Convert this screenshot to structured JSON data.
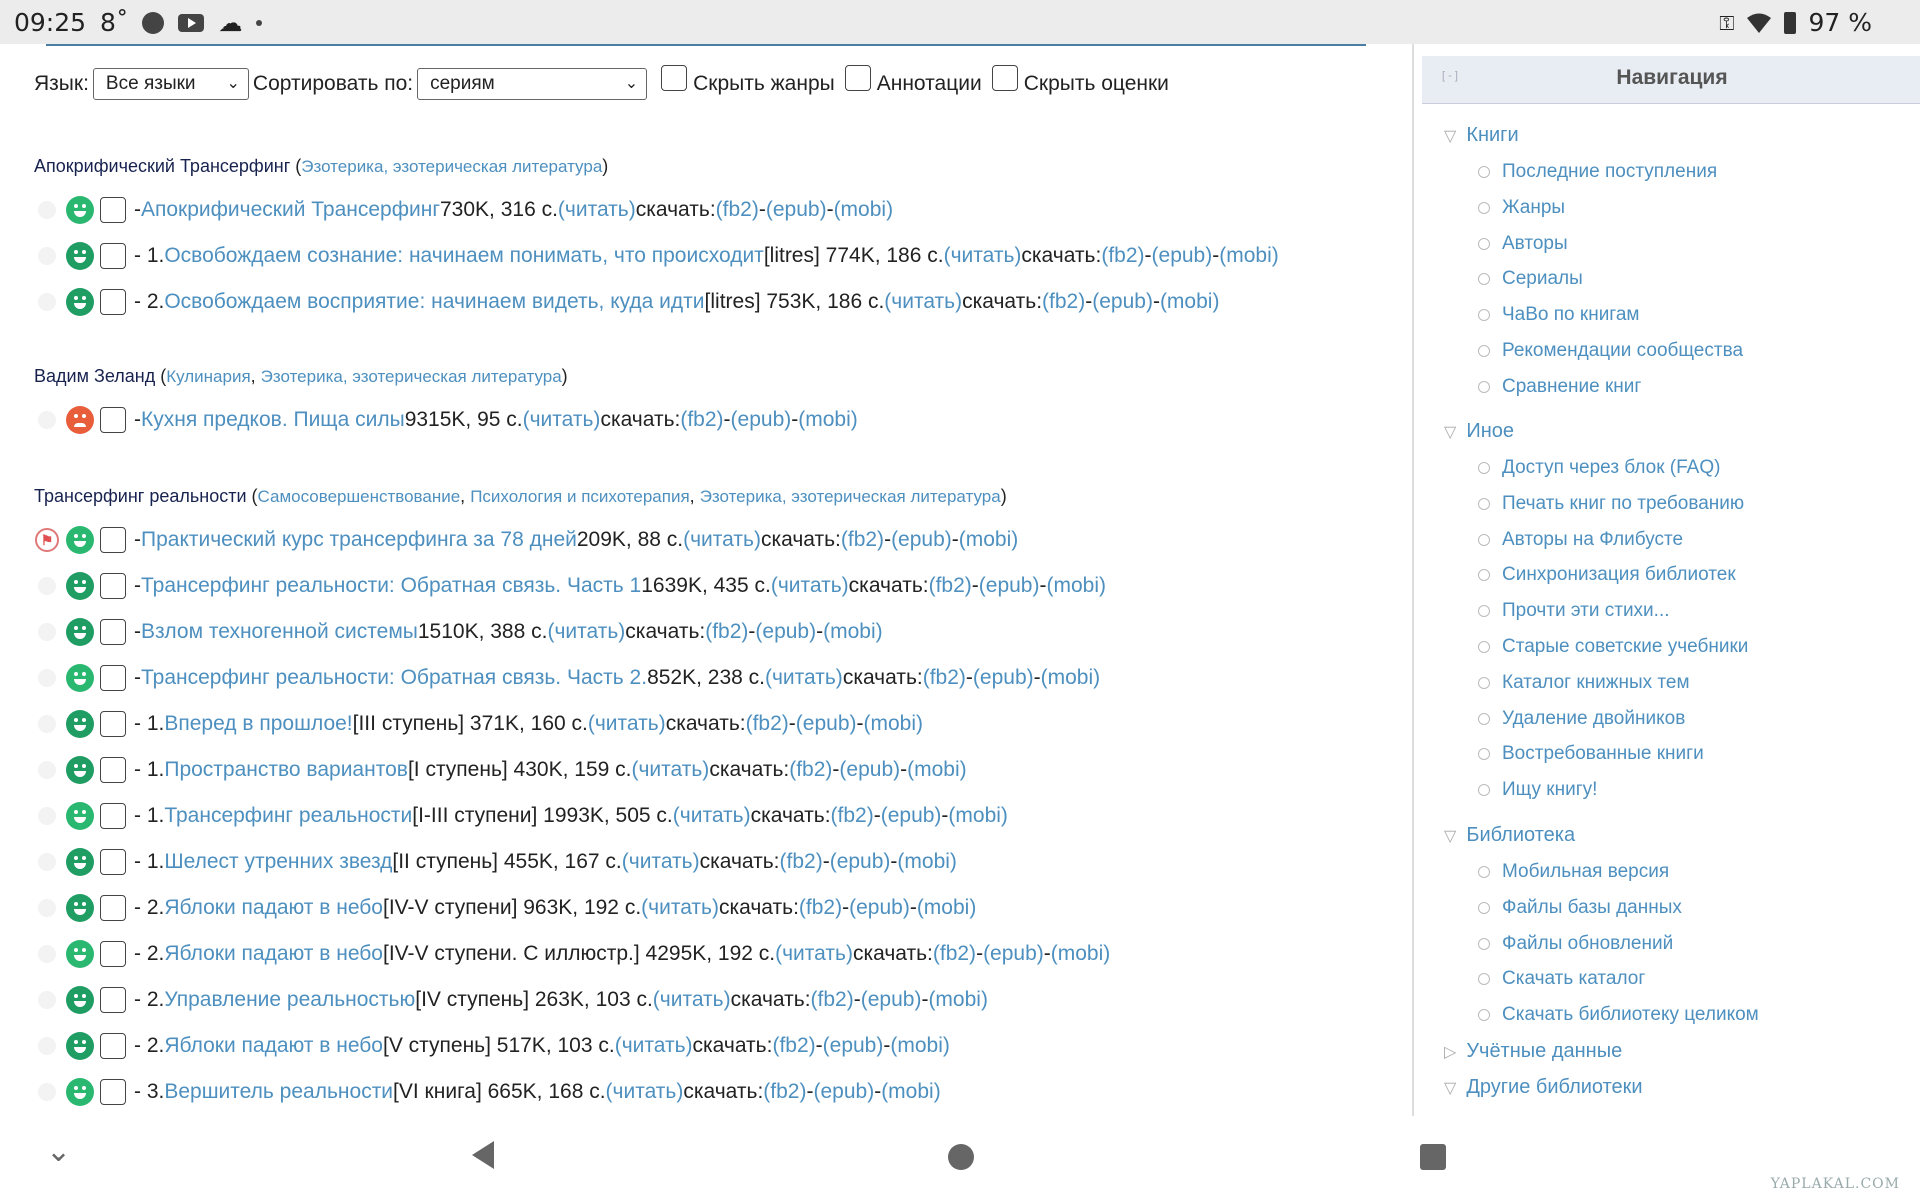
{
  "status_bar": {
    "time": "09:25",
    "temp": "8˚",
    "battery": "97 %"
  },
  "controls": {
    "lang_label": "Язык:",
    "lang_value": "Все языки",
    "sort_label": "Сортировать по:",
    "sort_value": "сериям",
    "hide_genres": "Скрыть жанры",
    "annotations": "Аннотации",
    "hide_ratings": "Скрыть оценки"
  },
  "groups": [
    {
      "title": "Апокрифический Трансерфинг",
      "genres": [
        "Эзотерика, эзотерическая литература"
      ],
      "books": [
        {
          "mark": "ghost",
          "face": "green",
          "prefix": "- ",
          "title": "Апокрифический Трансерфинг",
          "info": " 730K, 316 с. "
        },
        {
          "mark": "ghost",
          "face": "green",
          "prefix": "- 1. ",
          "title": "Освобождаем сознание: начинаем понимать, что происходит",
          "info": " [litres] 774K, 186 с. "
        },
        {
          "mark": "ghost",
          "face": "green",
          "prefix": "- 2. ",
          "title": "Освобождаем восприятие: начинаем видеть, куда идти",
          "info": " [litres] 753K, 186 с. "
        }
      ]
    },
    {
      "title": "Вадим Зеланд",
      "genres": [
        "Кулинария",
        "Эзотерика, эзотерическая литература"
      ],
      "books": [
        {
          "mark": "ghost",
          "face": "sad",
          "prefix": "- ",
          "title": "Кухня предков. Пища силы",
          "info": " 9315K, 95 с. "
        }
      ]
    },
    {
      "title": "Трансерфинг реальности",
      "genres": [
        "Самосовершенствование",
        "Психология и психотерапия",
        "Эзотерика, эзотерическая литература"
      ],
      "books": [
        {
          "mark": "flag",
          "face": "green",
          "prefix": "- ",
          "title": "Практический курс трансерфинга за 78 дней",
          "info": " 209K, 88 с. "
        },
        {
          "mark": "ghost",
          "face": "green",
          "prefix": "- ",
          "title": "Трансерфинг реальности: Обратная связь. Часть 1",
          "info": " 1639K, 435 с. "
        },
        {
          "mark": "ghost",
          "face": "green",
          "prefix": "- ",
          "title": "Взлом техногенной системы",
          "info": " 1510K, 388 с. "
        },
        {
          "mark": "ghost",
          "face": "green",
          "prefix": "- ",
          "title": "Трансерфинг реальности: Обратная связь. Часть 2.",
          "info": " 852K, 238 с. "
        },
        {
          "mark": "ghost",
          "face": "green",
          "prefix": "- 1. ",
          "title": "Вперед в прошлое!",
          "info": " [III ступень] 371K, 160 с. "
        },
        {
          "mark": "ghost",
          "face": "green",
          "prefix": "- 1. ",
          "title": "Пространство вариантов",
          "info": " [I ступень] 430K, 159 с. "
        },
        {
          "mark": "ghost",
          "face": "green",
          "prefix": "- 1. ",
          "title": "Трансерфинг реальности",
          "info": " [I-III ступени] 1993K, 505 с. "
        },
        {
          "mark": "ghost",
          "face": "green",
          "prefix": "- 1. ",
          "title": "Шелест утренних звезд",
          "info": " [II ступень] 455K, 167 с. "
        },
        {
          "mark": "ghost",
          "face": "green",
          "prefix": "- 2. ",
          "title": "Яблоки падают в небо",
          "info": " [IV-V ступени] 963K, 192 с. "
        },
        {
          "mark": "ghost",
          "face": "green",
          "prefix": "- 2. ",
          "title": "Яблоки падают в небо",
          "info": " [IV-V ступени. С иллюстр.] 4295K, 192 с. "
        },
        {
          "mark": "ghost",
          "face": "green",
          "prefix": "- 2. ",
          "title": "Управление реальностью",
          "info": " [IV ступень] 263K, 103 с. "
        },
        {
          "mark": "ghost",
          "face": "green",
          "prefix": "- 2. ",
          "title": "Яблоки падают в небо",
          "info": " [V ступень] 517K, 103 с. "
        },
        {
          "mark": "ghost",
          "face": "green",
          "prefix": "- 3. ",
          "title": "Вершитель реальности",
          "info": " [VI книга] 665K, 168 с. "
        }
      ]
    }
  ],
  "links": {
    "read": "(читать)",
    "download": " скачать: ",
    "fb2": "(fb2)",
    "epub": "(epub)",
    "mobi": "(mobi)",
    "sep": " - "
  },
  "nav": {
    "collapse": "[ - ]",
    "title": "Навигация",
    "sections": [
      {
        "label": "Книги",
        "open": true,
        "items": [
          "Последние поступления",
          "Жанры",
          "Авторы",
          "Сериалы",
          "ЧаВо по книгам",
          "Рекомендации сообщества",
          "Сравнение книг"
        ]
      },
      {
        "label": "Иное",
        "open": true,
        "items": [
          "Доступ через блок (FAQ)",
          "Печать книг по требованию",
          "Авторы на Флибусте",
          "Синхронизация библиотек",
          "Прочти эти стихи...",
          "Старые советские учебники",
          "Каталог книжных тем",
          "Удаление двойников",
          "Востребованные книги",
          "Ищу книгу!"
        ]
      },
      {
        "label": "Библиотека",
        "open": true,
        "items": [
          "Мобильная версия",
          "Файлы базы данных",
          "Файлы обновлений",
          "Скачать каталог",
          "Скачать библиотеку целиком"
        ]
      },
      {
        "label": "Учётные данные",
        "open": false,
        "items": []
      },
      {
        "label": "Другие библиотеки",
        "open": true,
        "items": []
      }
    ]
  },
  "watermark": "YAPLAKAL.COM"
}
